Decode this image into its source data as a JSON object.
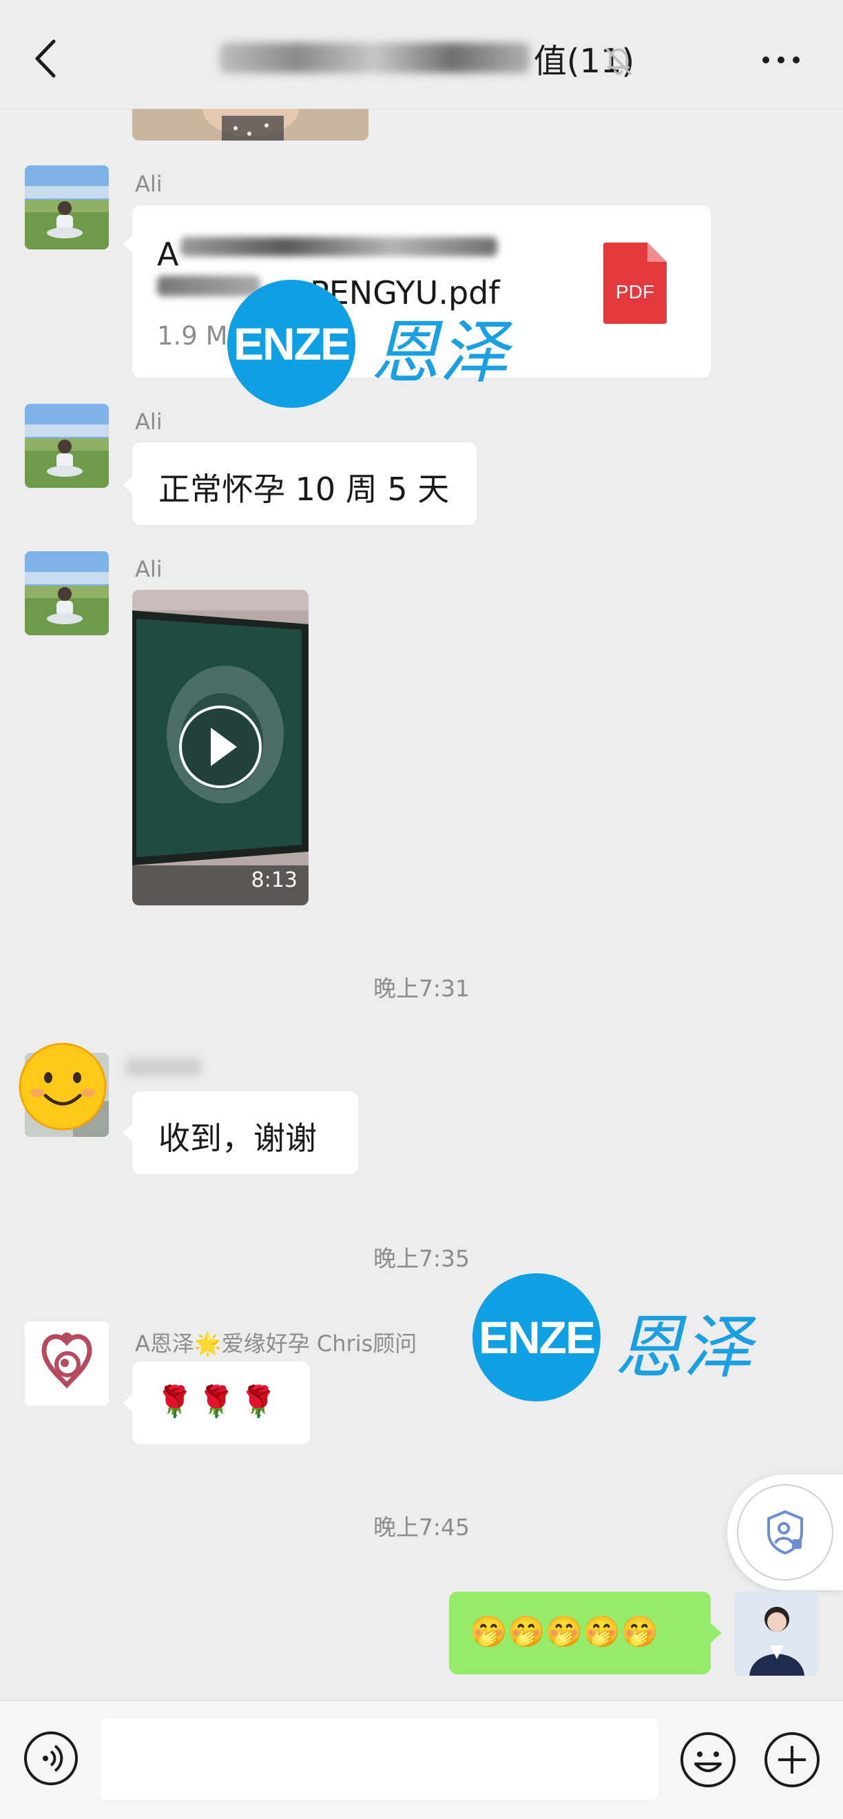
{
  "header": {
    "title_suffix": "值(11)",
    "back_icon": "chevron-left-icon",
    "mute_icon": "bell-off-icon",
    "more_icon": "more-dots-icon"
  },
  "messages": [
    {
      "sender": "Ali",
      "file": {
        "name_line1": "A",
        "name_line2": "PENGYU.pdf",
        "size": "1.9 M",
        "badge": "PDF"
      }
    },
    {
      "sender": "Ali",
      "text": "正常怀孕 10 周 5 天"
    },
    {
      "sender": "Ali",
      "video": {
        "duration": "8:13"
      }
    },
    {
      "text": "收到，谢谢"
    },
    {
      "sender": "A恩泽🌟爱缘好孕 Chris顾问",
      "text": "🌹🌹🌹"
    },
    {
      "text": "🤭🤭🤭🤭🤭"
    }
  ],
  "timestamps": [
    "晚上7:31",
    "晚上7:35",
    "晚上7:45"
  ],
  "watermark": {
    "latin": "ENZE",
    "chinese": "恩泽"
  },
  "colors": {
    "background": "#ededed",
    "bubble_self": "#95ec69",
    "watermark": "#0ea0e2",
    "pdf": "#e4393c"
  }
}
